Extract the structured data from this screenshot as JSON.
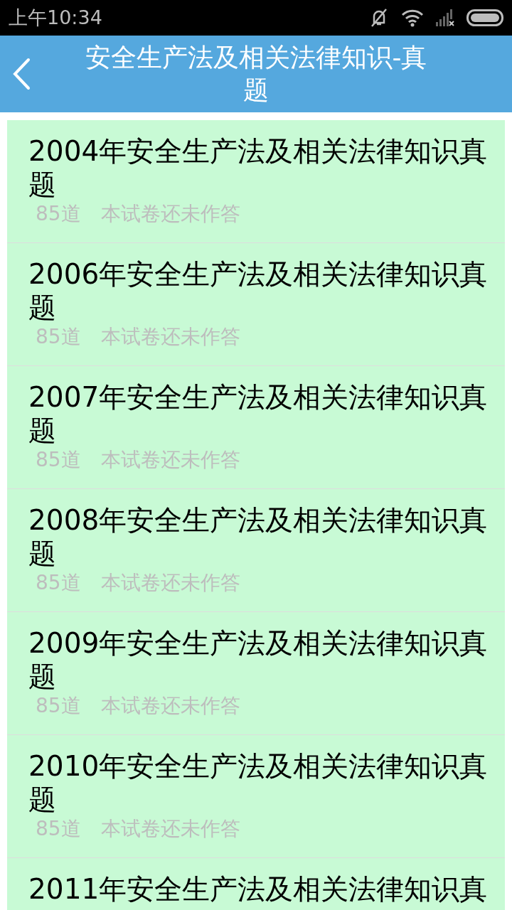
{
  "status_bar": {
    "time": "上午10:34"
  },
  "header": {
    "title": "安全生产法及相关法律知识-真题"
  },
  "papers": [
    {
      "title": "2004年安全生产法及相关法律知识真题",
      "count": "85道",
      "state": "本试卷还未作答"
    },
    {
      "title": "2006年安全生产法及相关法律知识真题",
      "count": "85道",
      "state": "本试卷还未作答"
    },
    {
      "title": "2007年安全生产法及相关法律知识真题",
      "count": "85道",
      "state": "本试卷还未作答"
    },
    {
      "title": "2008年安全生产法及相关法律知识真题",
      "count": "85道",
      "state": "本试卷还未作答"
    },
    {
      "title": "2009年安全生产法及相关法律知识真题",
      "count": "85道",
      "state": "本试卷还未作答"
    },
    {
      "title": "2010年安全生产法及相关法律知识真题",
      "count": "85道",
      "state": "本试卷还未作答"
    },
    {
      "title": "2011年安全生产法及相关法律知识真"
    }
  ]
}
